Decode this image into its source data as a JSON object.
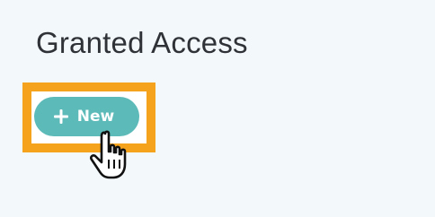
{
  "page": {
    "title": "Granted Access"
  },
  "toolbar": {
    "new_button_label": "New",
    "new_button_icon": "plus-icon",
    "cursor_icon": "hand-pointer-icon"
  },
  "colors": {
    "background": "#f3f8fb",
    "title_text": "#2f3338",
    "button_fill": "#5cbab8",
    "button_text": "#ffffff",
    "highlight": "#f5a31c"
  }
}
